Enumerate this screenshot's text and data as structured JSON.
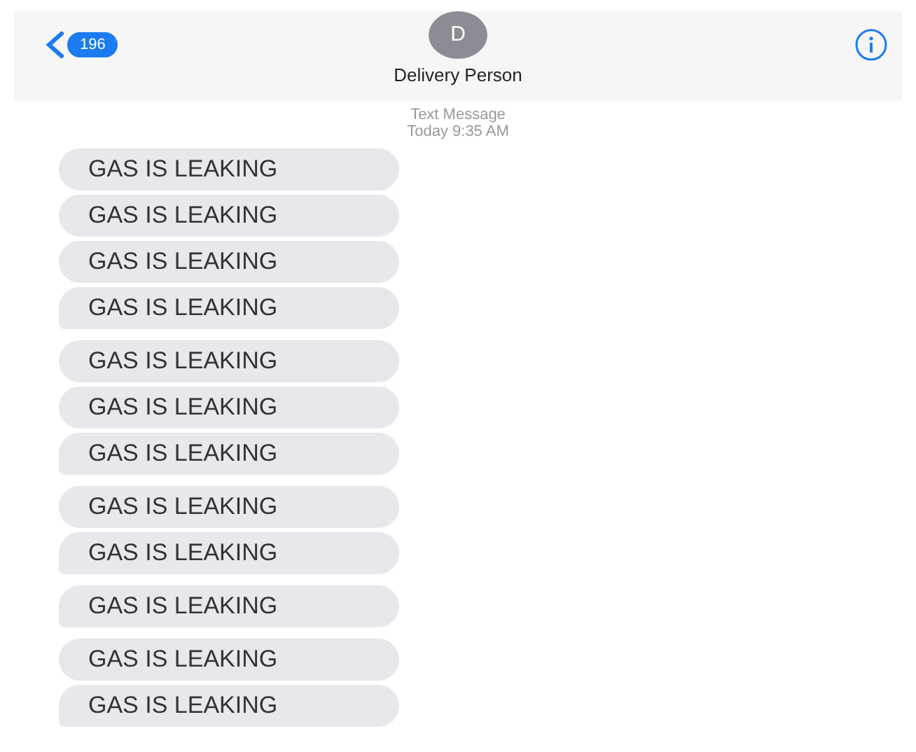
{
  "header": {
    "back_badge": "196",
    "avatar_initial": "D",
    "contact_name": "Delivery Person"
  },
  "thread_info": {
    "service": "Text Message",
    "timestamp": "Today 9:35 AM"
  },
  "message_groups": [
    {
      "messages": [
        "GAS IS LEAKING",
        "GAS IS LEAKING",
        "GAS IS LEAKING",
        "GAS IS LEAKING"
      ]
    },
    {
      "messages": [
        "GAS IS LEAKING",
        "GAS IS LEAKING",
        "GAS IS LEAKING"
      ]
    },
    {
      "messages": [
        "GAS IS LEAKING",
        "GAS IS LEAKING"
      ]
    },
    {
      "messages": [
        "GAS IS LEAKING"
      ]
    },
    {
      "messages": [
        "GAS IS LEAKING",
        "GAS IS LEAKING"
      ]
    }
  ]
}
